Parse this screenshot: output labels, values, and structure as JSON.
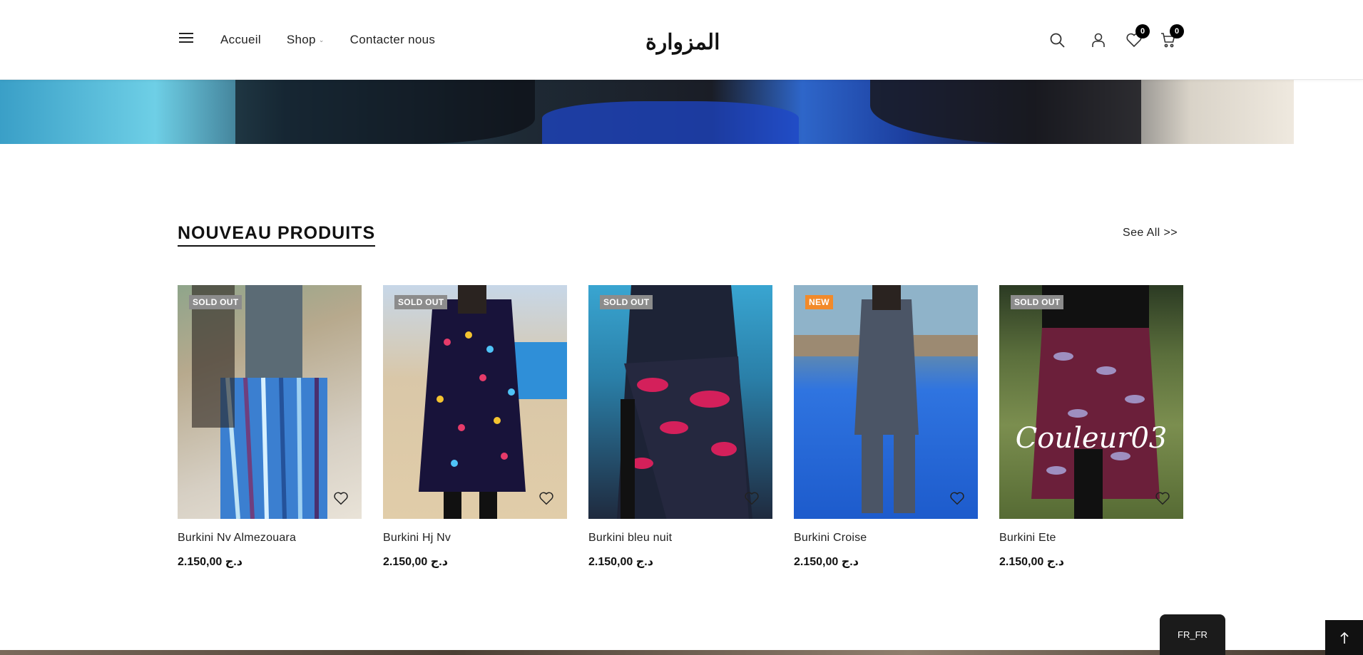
{
  "header": {
    "nav": [
      {
        "label": "Accueil"
      },
      {
        "label": "Shop"
      },
      {
        "label": "Contacter nous"
      }
    ],
    "logo_text": "المزوارة",
    "wishlist_count": "0",
    "cart_count": "0"
  },
  "section": {
    "title": "NOUVEAU PRODUITS",
    "see_all": "See All  >>"
  },
  "products": [
    {
      "name": "Burkini Nv Almezouara",
      "price": "2.150,00 د.ج",
      "tag": "SOLD OUT"
    },
    {
      "name": "Burkini Hj Nv",
      "price": "2.150,00 د.ج",
      "tag": "SOLD OUT"
    },
    {
      "name": "Burkini bleu nuit",
      "price": "2.150,00 د.ج",
      "tag": "SOLD OUT"
    },
    {
      "name": "Burkini Croise",
      "price": "2.150,00 د.ج",
      "tag": "NEW"
    },
    {
      "name": "Burkini Ete",
      "price": "2.150,00 د.ج",
      "tag": "SOLD OUT",
      "overlay_text": "Couleur03"
    }
  ],
  "language": "FR_FR",
  "colors": {
    "sold_out_tag": "#8c8c8c",
    "new_tag": "#f28a2a",
    "badge": "#000000"
  }
}
